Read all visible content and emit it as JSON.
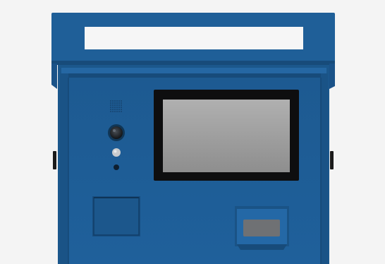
{
  "scene": {
    "subject": "kiosk-terminal",
    "colors": {
      "background": "#f4f4f4",
      "body_blue": "#1f5f98",
      "body_blue_dark": "#174b7a",
      "body_blue_light": "#2a6fae",
      "screen_bezel": "#0e0e0f",
      "screen": "#9c9c9c",
      "sign_panel": "#f6f6f6",
      "slot": "#6f7174"
    },
    "icons": [
      "speaker-grille-icon",
      "camera-lens-icon",
      "indicator-led-icon",
      "sensor-dot-icon"
    ]
  }
}
